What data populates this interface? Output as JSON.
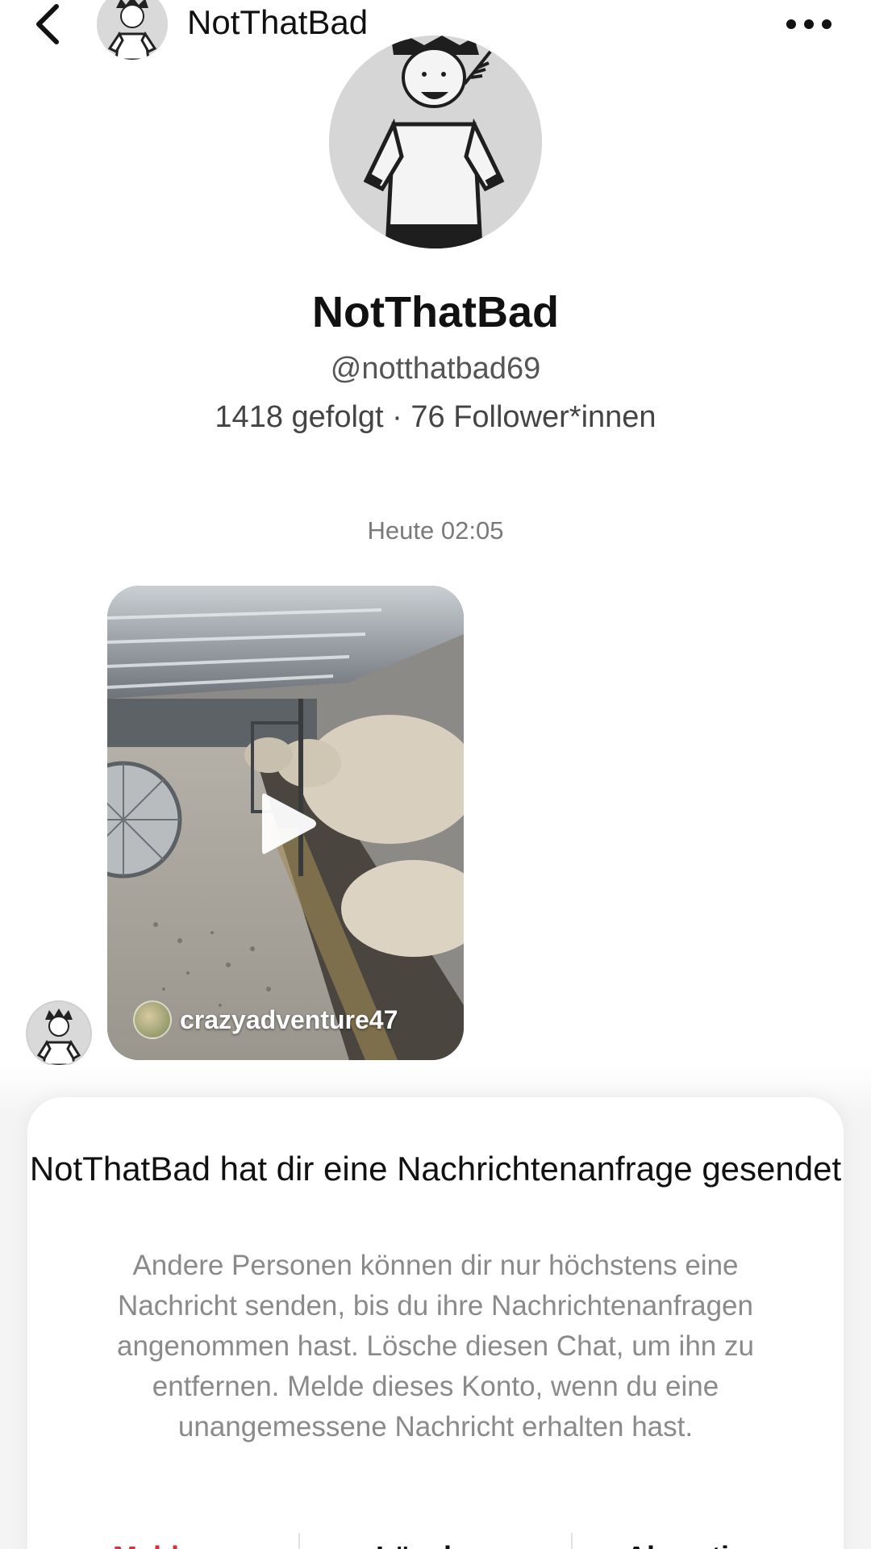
{
  "header": {
    "title": "NotThatBad",
    "back_icon": "chevron-left-icon",
    "more_icon": "more-horizontal-icon"
  },
  "profile": {
    "display_name": "NotThatBad",
    "handle": "@notthatbad69",
    "stats": "1418 gefolgt · 76 Follower*innen"
  },
  "chat": {
    "timestamp": "Heute 02:05",
    "shared_video": {
      "author": "crazyadventure47",
      "play_icon": "play-icon"
    }
  },
  "request_panel": {
    "title": "NotThatBad hat dir eine Nachrichtenanfrage gesendet",
    "body": "Andere Personen können dir nur höchstens eine Nachricht senden, bis du ihre Nachrichtenanfragen angenommen hast. Lösche diesen Chat, um ihn zu entfernen. Melde dieses Konto, wenn du eine unangemessene Nachricht erhalten hast.",
    "actions": [
      {
        "label": "Melden",
        "color": "#e5293d"
      },
      {
        "label": "Löschen",
        "color": "#111111"
      },
      {
        "label": "Akzeptieren",
        "color": "#111111"
      }
    ]
  },
  "colors": {
    "accent_red": "#e5293d",
    "text_secondary": "#8a8a8a"
  }
}
